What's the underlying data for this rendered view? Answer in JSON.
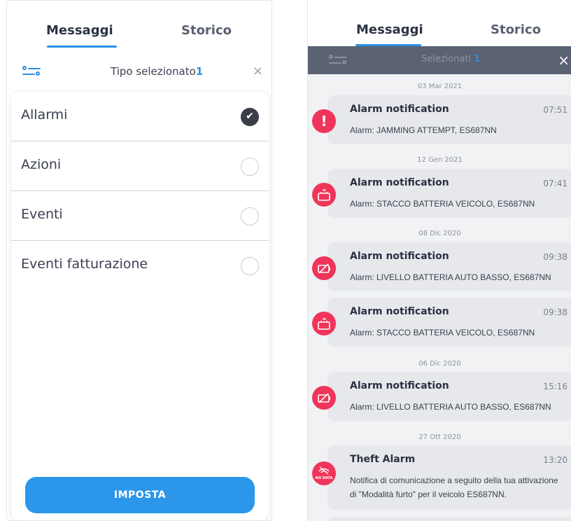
{
  "left": {
    "tabs": {
      "messages": "Messaggi",
      "history": "Storico"
    },
    "filter": {
      "label": "Tipo selezionato",
      "count": "1",
      "close": "×"
    },
    "options": [
      {
        "label": "Allarmi",
        "checked": true
      },
      {
        "label": "Azioni",
        "checked": false
      },
      {
        "label": "Eventi",
        "checked": false
      },
      {
        "label": "Eventi fatturazione",
        "checked": false
      }
    ],
    "button": "IMPOSTA",
    "checkmark": "✔"
  },
  "right": {
    "tabs": {
      "messages": "Messaggi",
      "history": "Storico"
    },
    "bar": {
      "label": "Selezionati",
      "count": "1",
      "close": "×"
    },
    "dates": [
      "03 Mar 2021",
      "12 Gen 2021",
      "08 Dic 2020",
      "06 Dic 2020",
      "27 Ott 2020"
    ],
    "notifications": [
      {
        "title": "Alarm notification",
        "time": "07:51",
        "body": "Alarm: JAMMING ATTEMPT, ES687NN",
        "icon": "exclamation-icon"
      },
      {
        "title": "Alarm notification",
        "time": "07:41",
        "body": "Alarm: STACCO BATTERIA VEICOLO, ES687NN",
        "icon": "battery-disconnect-icon"
      },
      {
        "title": "Alarm notification",
        "time": "09:38",
        "body": "Alarm: LIVELLO BATTERIA AUTO BASSO, ES687NN",
        "icon": "battery-low-icon"
      },
      {
        "title": "Alarm notification",
        "time": "09:38",
        "body": "Alarm: STACCO BATTERIA VEICOLO, ES687NN",
        "icon": "battery-disconnect-icon"
      },
      {
        "title": "Alarm notification",
        "time": "15:16",
        "body": "Alarm: LIVELLO BATTERIA AUTO BASSO, ES687NN",
        "icon": "battery-low-icon"
      },
      {
        "title": "Theft Alarm",
        "time": "13:20",
        "body": "Notifica di comunicazione a seguito della tua attivazione di \"Modalità furto\" per il veicolo ES687NN.",
        "icon": "no-data-icon"
      }
    ],
    "no_data_text": "NO DATA",
    "exclamation": "!"
  },
  "colors": {
    "accent": "#2b8fe6",
    "alarm": "#f0345a",
    "bar": "#5a6274",
    "button": "#2c97ea"
  }
}
